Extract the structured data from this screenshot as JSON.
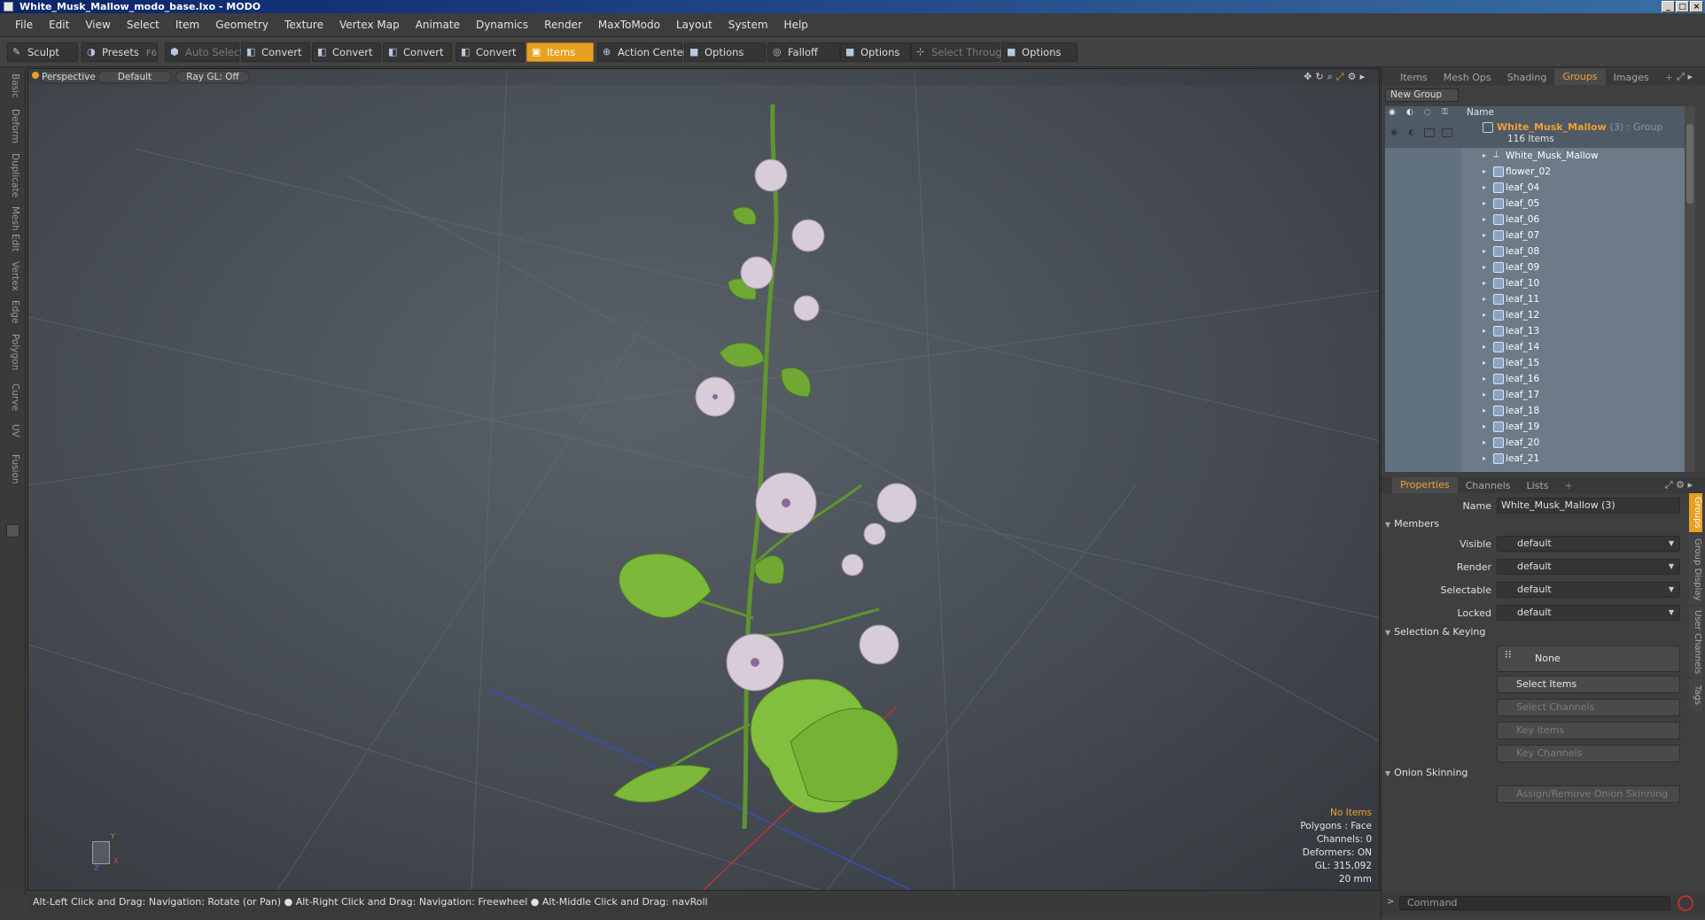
{
  "window": {
    "title": "White_Musk_Mallow_modo_base.lxo - MODO",
    "controls": [
      "_",
      "□",
      "×"
    ]
  },
  "menu": [
    "File",
    "Edit",
    "View",
    "Select",
    "Item",
    "Geometry",
    "Texture",
    "Vertex Map",
    "Animate",
    "Dynamics",
    "Render",
    "MaxToModo",
    "Layout",
    "System",
    "Help"
  ],
  "toolbar": {
    "sculpt": "Sculpt",
    "presets": "Presets",
    "presets_key": "F6",
    "auto_select": "Auto Select",
    "convert1": "Convert",
    "convert2": "Convert",
    "convert3": "Convert",
    "convert4": "Convert",
    "items": "Items",
    "action_center": "Action Center",
    "options1": "Options",
    "falloff": "Falloff",
    "options2": "Options",
    "select_through": "Select Through",
    "options3": "Options"
  },
  "left_tabs": [
    "Basic",
    "Deform",
    "Duplicate",
    "Mesh Edit",
    "Vertex",
    "Edge",
    "Polygon",
    "Curve",
    "UV",
    "Fusion"
  ],
  "viewport": {
    "view": "Perspective",
    "shading": "Default",
    "raygl": "Ray GL: Off",
    "stats": {
      "items": "No Items",
      "polygons": "Polygons : Face",
      "channels": "Channels: 0",
      "deformers": "Deformers: ON",
      "gl": "GL: 315,092",
      "scale": "20 mm"
    },
    "axis": {
      "x": "X",
      "y": "Y",
      "z": "Z"
    }
  },
  "status": "Alt-Left Click and Drag: Navigation: Rotate (or Pan) ● Alt-Right Click and Drag: Navigation: Freewheel ● Alt-Middle Click and Drag: navRoll",
  "top_tabs": [
    "Items",
    "Mesh Ops",
    "Shading",
    "Groups",
    "Images"
  ],
  "top_tab_active": "Groups",
  "groups": {
    "new_group": "New Group",
    "col_name": "Name",
    "group_name": "White_Musk_Mallow",
    "group_suffix": "(3) : Group",
    "group_count": "116 Items",
    "members": [
      "White_Musk_Mallow",
      "flower_02",
      "leaf_04",
      "leaf_05",
      "leaf_06",
      "leaf_07",
      "leaf_08",
      "leaf_09",
      "leaf_10",
      "leaf_11",
      "leaf_12",
      "leaf_13",
      "leaf_14",
      "leaf_15",
      "leaf_16",
      "leaf_17",
      "leaf_18",
      "leaf_19",
      "leaf_20",
      "leaf_21"
    ]
  },
  "bottom_tabs": [
    "Properties",
    "Channels",
    "Lists"
  ],
  "properties": {
    "name_label": "Name",
    "name_value": "White_Musk_Mallow (3)",
    "members_section": "Members",
    "visible_label": "Visible",
    "visible_value": "default",
    "render_label": "Render",
    "render_value": "default",
    "selectable_label": "Selectable",
    "selectable_value": "default",
    "locked_label": "Locked",
    "locked_value": "default",
    "selkey_section": "Selection & Keying",
    "none": "None",
    "select_items": "Select Items",
    "select_channels": "Select Channels",
    "key_items": "Key Items",
    "key_channels": "Key Channels",
    "onion_section": "Onion Skinning",
    "assign_onion": "Assign/Remove Onion Skinning"
  },
  "side_tabs": [
    "Groups",
    "Group Display",
    "User Channels",
    "Tags"
  ],
  "command": {
    "placeholder": "Command"
  },
  "colors": {
    "accent": "#e8a020",
    "leaf": "#7cb83a",
    "petal": "#d8ccd8"
  }
}
